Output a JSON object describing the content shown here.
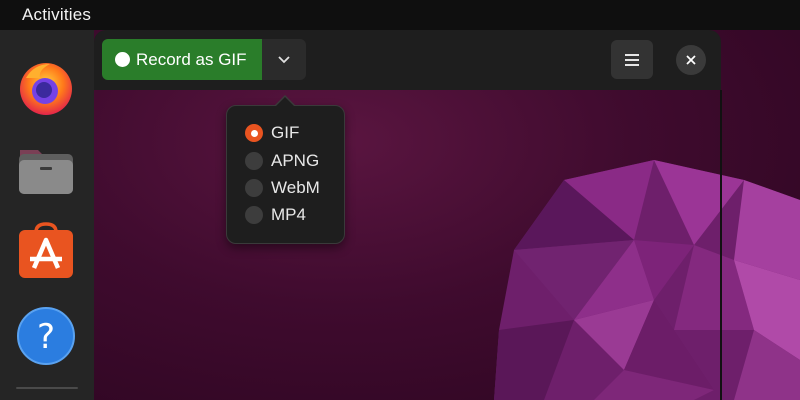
{
  "topbar": {
    "activities_label": "Activities"
  },
  "dock": {
    "apps": [
      {
        "name": "Firefox",
        "icon": "firefox-icon"
      },
      {
        "name": "Files",
        "icon": "folder-icon"
      },
      {
        "name": "App Center",
        "icon": "app-store-icon"
      },
      {
        "name": "Help",
        "icon": "help-icon",
        "glyph": "?"
      }
    ]
  },
  "toolbar": {
    "record_label": "Record as GIF",
    "dropdown_icon": "chevron-down-icon",
    "menu_icon": "hamburger-menu-icon",
    "close_icon": "close-icon",
    "record_color": "#2a7d2a"
  },
  "format_menu": {
    "options": [
      {
        "label": "GIF",
        "selected": true
      },
      {
        "label": "APNG",
        "selected": false
      },
      {
        "label": "WebM",
        "selected": false
      },
      {
        "label": "MP4",
        "selected": false
      }
    ],
    "accent_color": "#e95420"
  }
}
